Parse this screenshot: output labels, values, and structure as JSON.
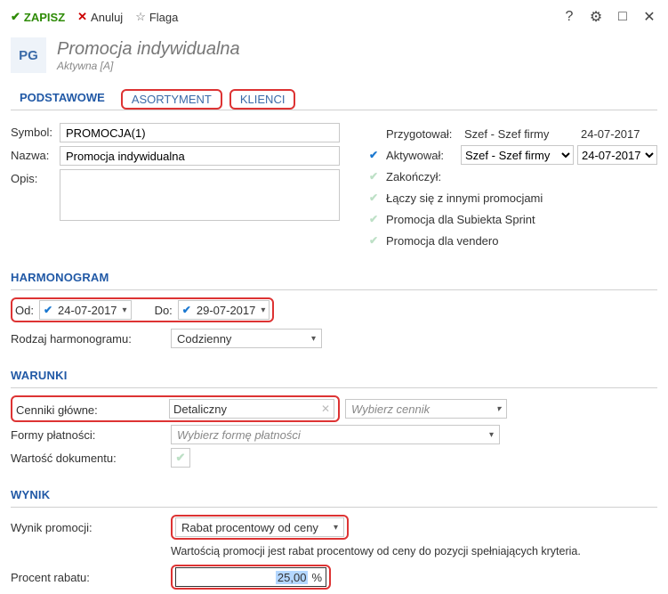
{
  "topbar": {
    "save": "ZAPISZ",
    "cancel": "Anuluj",
    "flag": "Flaga"
  },
  "header": {
    "badge": "PG",
    "title": "Promocja indywidualna",
    "subtitle": "Aktywna [A]"
  },
  "tabs": {
    "basic": "PODSTAWOWE",
    "asort": "ASORTYMENT",
    "klienci": "KLIENCI"
  },
  "form": {
    "symbol_label": "Symbol:",
    "symbol_value": "PROMOCJA(1)",
    "name_label": "Nazwa:",
    "name_value": "Promocja indywidualna",
    "opis_label": "Opis:",
    "opis_value": ""
  },
  "right": {
    "prepared_label": "Przygotował:",
    "prepared_value": "Szef - Szef firmy",
    "prepared_date": "24-07-2017",
    "activated_label": "Aktywował:",
    "activated_value": "Szef - Szef firmy",
    "activated_date": "24-07-2017",
    "finished_label": "Zakończył:",
    "combine_label": "Łączy się z innymi promocjami",
    "subiekt_label": "Promocja dla Subiekta Sprint",
    "vendero_label": "Promocja dla vendero"
  },
  "sections": {
    "harmonogram": "HARMONOGRAM",
    "warunki": "WARUNKI",
    "wynik": "WYNIK"
  },
  "harmonogram": {
    "od_label": "Od:",
    "od_value": "24-07-2017",
    "do_label": "Do:",
    "do_value": "29-07-2017",
    "type_label": "Rodzaj harmonogramu:",
    "type_value": "Codzienny"
  },
  "warunki": {
    "cenniki_label": "Cenniki główne:",
    "cenniki_value": "Detaliczny",
    "cennik_placeholder": "Wybierz cennik",
    "formy_label": "Formy płatności:",
    "formy_placeholder": "Wybierz formę płatności",
    "wartosc_label": "Wartość dokumentu:"
  },
  "wynik": {
    "type_label": "Wynik promocji:",
    "type_value": "Rabat procentowy od ceny",
    "help_text": "Wartością promocji jest rabat procentowy od ceny do pozycji spełniających kryteria.",
    "pct_label": "Procent rabatu:",
    "pct_value": "25,00",
    "pct_unit": "%"
  }
}
